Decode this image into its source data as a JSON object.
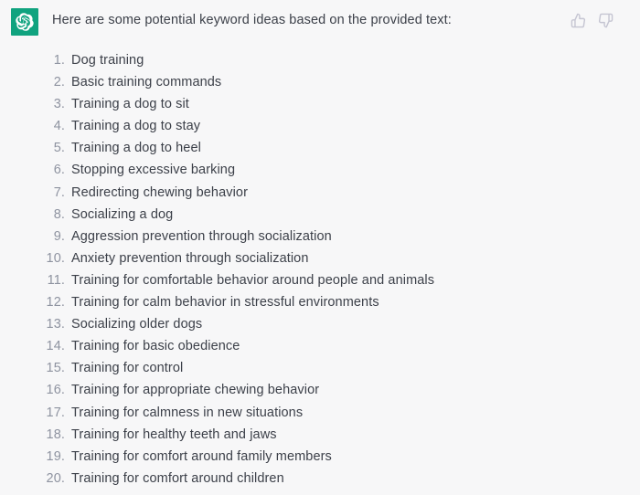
{
  "message": {
    "avatar": {
      "icon": "openai-logo-icon",
      "background_color": "#10a37f",
      "glyph_color": "#ffffff"
    },
    "intro_text": "Here are some potential keyword ideas based on the provided text:",
    "text_color": "#3c4049",
    "marker_color": "#8e93a0",
    "background_color": "#f7f7f8",
    "keyword_list": [
      {
        "number": "1.",
        "label": "Dog training"
      },
      {
        "number": "2.",
        "label": "Basic training commands"
      },
      {
        "number": "3.",
        "label": "Training a dog to sit"
      },
      {
        "number": "4.",
        "label": "Training a dog to stay"
      },
      {
        "number": "5.",
        "label": "Training a dog to heel"
      },
      {
        "number": "6.",
        "label": "Stopping excessive barking"
      },
      {
        "number": "7.",
        "label": "Redirecting chewing behavior"
      },
      {
        "number": "8.",
        "label": "Socializing a dog"
      },
      {
        "number": "9.",
        "label": "Aggression prevention through socialization"
      },
      {
        "number": "10.",
        "label": "Anxiety prevention through socialization"
      },
      {
        "number": "11.",
        "label": "Training for comfortable behavior around people and animals"
      },
      {
        "number": "12.",
        "label": "Training for calm behavior in stressful environments"
      },
      {
        "number": "13.",
        "label": "Socializing older dogs"
      },
      {
        "number": "14.",
        "label": "Training for basic obedience"
      },
      {
        "number": "15.",
        "label": "Training for control"
      },
      {
        "number": "16.",
        "label": "Training for appropriate chewing behavior"
      },
      {
        "number": "17.",
        "label": "Training for calmness in new situations"
      },
      {
        "number": "18.",
        "label": "Training for healthy teeth and jaws"
      },
      {
        "number": "19.",
        "label": "Training for comfort around family members"
      },
      {
        "number": "20.",
        "label": "Training for comfort around children"
      }
    ],
    "feedback": {
      "thumbs_up_icon": "thumbs-up-icon",
      "thumbs_down_icon": "thumbs-down-icon",
      "icon_color": "#c5c5d2"
    }
  }
}
